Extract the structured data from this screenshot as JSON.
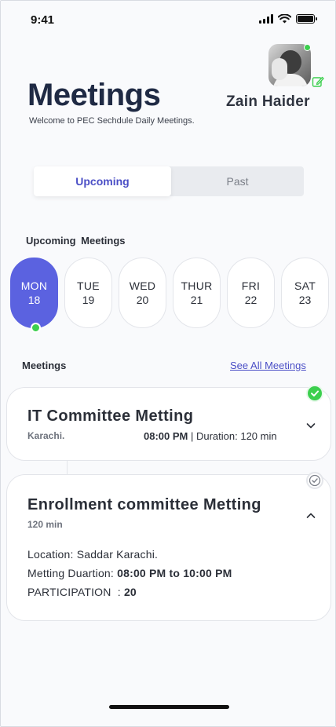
{
  "status_bar": {
    "time": "9:41"
  },
  "header": {
    "title": "Meetings",
    "subtitle": "Welcome to PEC Sechdule Daily Meetings.",
    "user_name": "Zain Haider"
  },
  "tabs": {
    "upcoming": "Upcoming",
    "past": "Past",
    "selected": "Upcoming"
  },
  "upcoming_section": {
    "label": "Upcoming  Meetings"
  },
  "days": [
    {
      "name": "MON",
      "num": "18",
      "active": true
    },
    {
      "name": "TUE",
      "num": "19"
    },
    {
      "name": "WED",
      "num": "20"
    },
    {
      "name": "THUR",
      "num": "21"
    },
    {
      "name": "FRI",
      "num": "22"
    },
    {
      "name": "SAT",
      "num": "23"
    }
  ],
  "meetings_section": {
    "label": "Meetings",
    "see_all": "See All Meetings"
  },
  "meetings": [
    {
      "title": "IT Committee Metting",
      "city": "Karachi.",
      "time": "08:00 PM",
      "duration": " | Duration: 120 min",
      "status": "done"
    },
    {
      "title": "Enrollment committee Metting",
      "duration_short": "120 min",
      "location": "Location: Saddar Karachi.",
      "duration_label": "Metting Duartion: ",
      "duration_value": "08:00 PM to 10:00 PM",
      "participation_label": "PARTICIPATION  : ",
      "participation_value": "20",
      "status": "pending"
    }
  ],
  "colors": {
    "accent": "#5b62e0",
    "link": "#4b4fc6",
    "online": "#3ccf4e",
    "title": "#1f2a44"
  },
  "icons": {
    "edit": "edit-pencil-icon",
    "chevron_down": "chevron-down-icon",
    "chevron_up": "chevron-up-icon",
    "check": "check-circle-icon"
  }
}
